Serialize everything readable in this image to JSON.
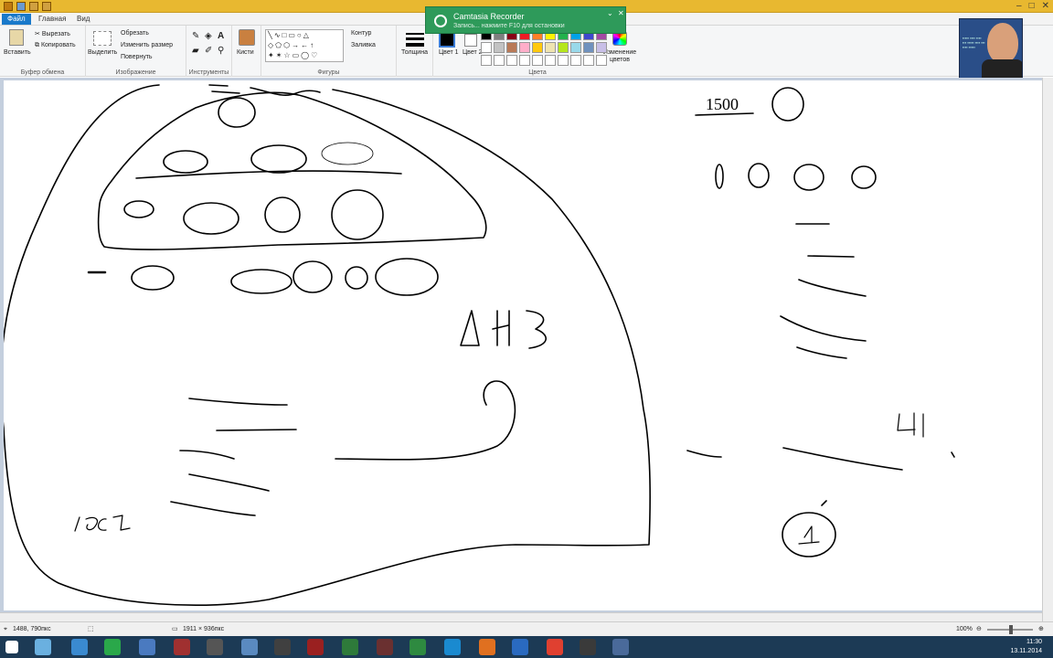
{
  "window": {
    "title_controls": [
      "–",
      "□",
      "✕"
    ]
  },
  "menu_tabs": [
    "Файл",
    "Главная",
    "Вид"
  ],
  "ribbon": {
    "clipboard": {
      "paste_label": "Вставить",
      "cut_label": "Вырезать",
      "copy_label": "Копировать",
      "group_label": "Буфер обмена"
    },
    "image": {
      "select_label": "Выделить",
      "crop_label": "Обрезать",
      "resize_label": "Изменить размер",
      "rotate_label": "Повернуть",
      "group_label": "Изображение"
    },
    "tools": {
      "group_label": "Инструменты",
      "brushes_label": "Кисти"
    },
    "shapes": {
      "outline_label": "Контур",
      "fill_label": "Заливка",
      "group_label": "Фигуры"
    },
    "thickness_label": "Толщина",
    "colors": {
      "color1_label": "Цвет 1",
      "color2_label": "Цвет 2",
      "edit_label": "Изменение цветов",
      "group_label": "Цвета"
    }
  },
  "palette": [
    "#000000",
    "#7f7f7f",
    "#880015",
    "#ed1c24",
    "#ff7f27",
    "#fff200",
    "#22b14c",
    "#00a2e8",
    "#3f48cc",
    "#a349a4",
    "#ffffff",
    "#c3c3c3",
    "#b97a57",
    "#ffaec9",
    "#ffc90e",
    "#efe4b0",
    "#b5e61d",
    "#99d9ea",
    "#7092be",
    "#c8bfe7",
    "#ffffff",
    "#ffffff",
    "#ffffff",
    "#ffffff",
    "#ffffff",
    "#ffffff",
    "#ffffff",
    "#ffffff",
    "#ffffff",
    "#ffffff"
  ],
  "notification": {
    "title": "Camtasia Recorder",
    "subtitle": "Запись... нажмите F10 для остановки"
  },
  "drawing": {
    "label_1500": "1500",
    "label_AU": "ΔЧЗ",
    "label_CO1": "ІСО1",
    "label_4": "4",
    "label_1": "1"
  },
  "statusbar": {
    "cursor_pos": "1488, 790пкс",
    "image_size": "1911 × 936пкс",
    "zoom": "100%"
  },
  "taskbar": {
    "time": "11:30",
    "date": "13.11.2014"
  }
}
